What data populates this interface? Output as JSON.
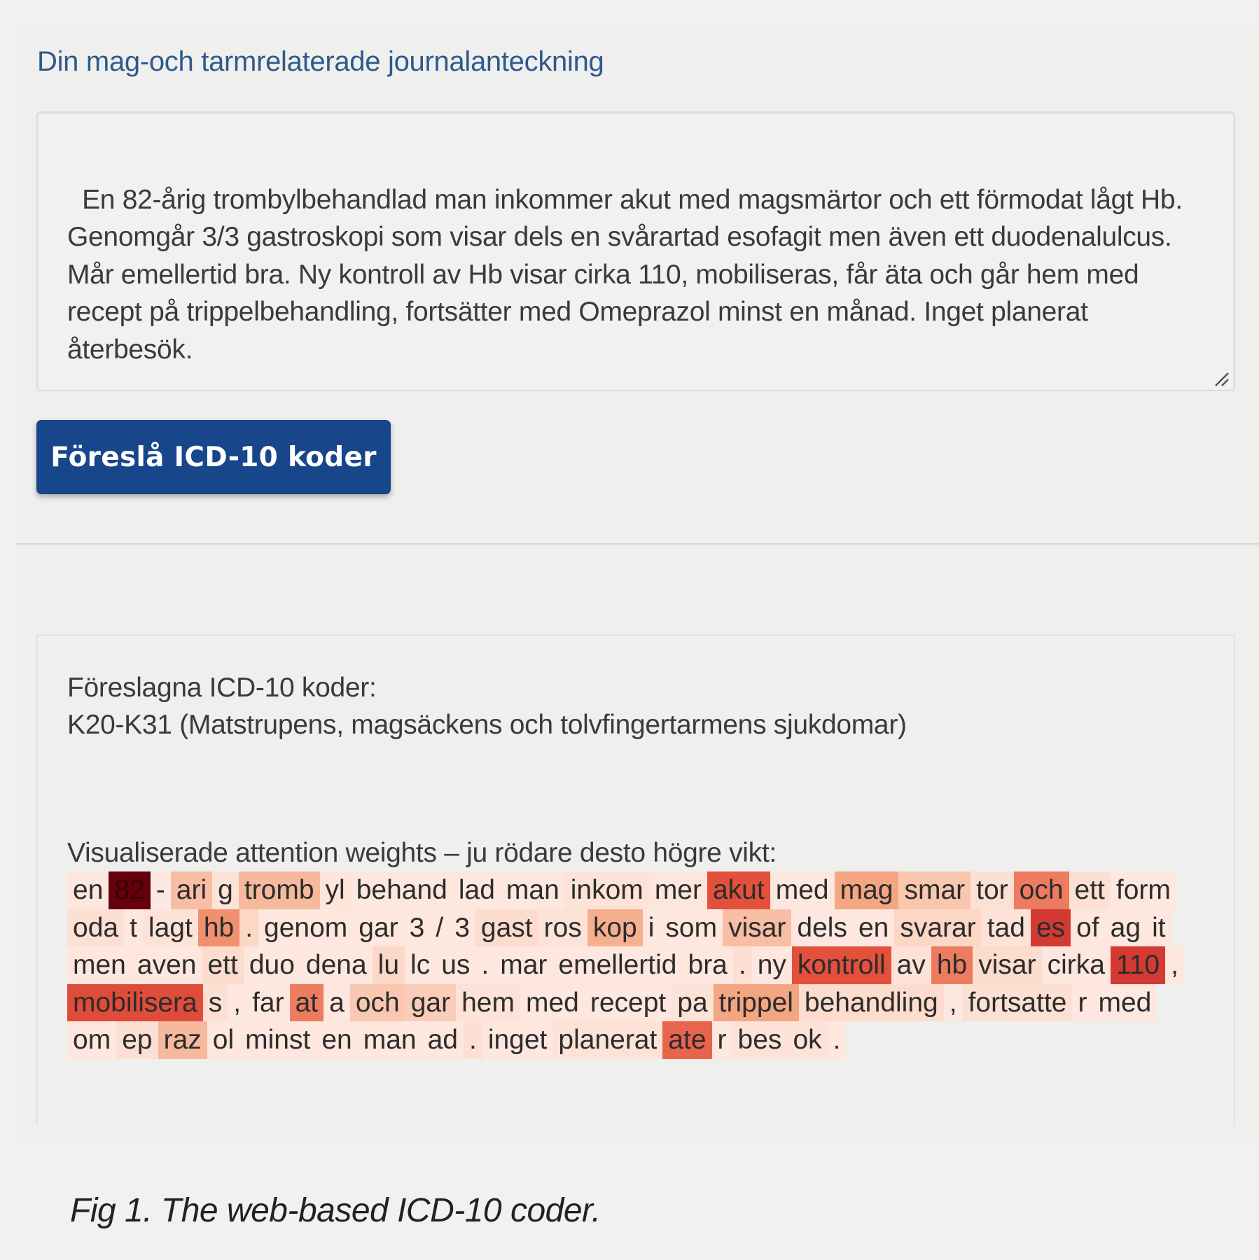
{
  "form": {
    "title": "Din mag-och tarmrelaterade journalanteckning",
    "note_text": "En 82-årig trombylbehandlad man inkommer akut med magsmärtor och ett förmodat lågt Hb. Genomgår 3/3 gastroskopi som visar dels en svårartad esofagit men även ett duodenalulcus. Mår emellertid bra. Ny kontroll av Hb visar cirka 110, mobiliseras, får äta och går hem med recept på trippelbehandling, fortsätter med Omeprazol minst en månad. Inget planerat återbesök.",
    "submit_label": "Föreslå ICD-10 koder"
  },
  "result": {
    "heading": "Föreslagna ICD-10 koder:",
    "code": "K20-K31 (Matstrupens, magsäckens och tolvfingertarmens sjukdomar)",
    "attention_heading": "Visualiserade attention weights – ju rödare desto högre vikt:",
    "tokens": [
      {
        "text": "en",
        "weight": 0.06
      },
      {
        "text": "82",
        "weight": 1.0
      },
      {
        "text": "-",
        "weight": 0.04
      },
      {
        "text": "ari",
        "weight": 0.3
      },
      {
        "text": "g",
        "weight": 0.1
      },
      {
        "text": "tromb",
        "weight": 0.32
      },
      {
        "text": "yl",
        "weight": 0.08
      },
      {
        "text": "behand",
        "weight": 0.06
      },
      {
        "text": "lad",
        "weight": 0.06
      },
      {
        "text": "man",
        "weight": 0.05
      },
      {
        "text": "inkom",
        "weight": 0.1
      },
      {
        "text": "mer",
        "weight": 0.07
      },
      {
        "text": "akut",
        "weight": 0.6
      },
      {
        "text": "med",
        "weight": 0.05
      },
      {
        "text": "mag",
        "weight": 0.4
      },
      {
        "text": "smar",
        "weight": 0.27
      },
      {
        "text": "tor",
        "weight": 0.12
      },
      {
        "text": "och",
        "weight": 0.5
      },
      {
        "text": "ett",
        "weight": 0.12
      },
      {
        "text": "form",
        "weight": 0.06
      },
      {
        "text": "oda",
        "weight": 0.12
      },
      {
        "text": "t",
        "weight": 0.06
      },
      {
        "text": "lagt",
        "weight": 0.1
      },
      {
        "text": "hb",
        "weight": 0.45
      },
      {
        "text": ".",
        "weight": 0.2
      },
      {
        "text": "genom",
        "weight": 0.06
      },
      {
        "text": "gar",
        "weight": 0.06
      },
      {
        "text": "3",
        "weight": 0.06
      },
      {
        "text": "/",
        "weight": 0.05
      },
      {
        "text": "3",
        "weight": 0.06
      },
      {
        "text": "gast",
        "weight": 0.16
      },
      {
        "text": "ros",
        "weight": 0.1
      },
      {
        "text": "kop",
        "weight": 0.36
      },
      {
        "text": "i",
        "weight": 0.06
      },
      {
        "text": "som",
        "weight": 0.06
      },
      {
        "text": "visar",
        "weight": 0.3
      },
      {
        "text": "dels",
        "weight": 0.06
      },
      {
        "text": "en",
        "weight": 0.06
      },
      {
        "text": "svarar",
        "weight": 0.2
      },
      {
        "text": "tad",
        "weight": 0.1
      },
      {
        "text": "es",
        "weight": 0.7
      },
      {
        "text": "of",
        "weight": 0.06
      },
      {
        "text": "ag",
        "weight": 0.06
      },
      {
        "text": "it",
        "weight": 0.06
      },
      {
        "text": "men",
        "weight": 0.06
      },
      {
        "text": "aven",
        "weight": 0.06
      },
      {
        "text": "ett",
        "weight": 0.16
      },
      {
        "text": "duo",
        "weight": 0.06
      },
      {
        "text": "dena",
        "weight": 0.06
      },
      {
        "text": "lu",
        "weight": 0.2
      },
      {
        "text": "lc",
        "weight": 0.06
      },
      {
        "text": "us",
        "weight": 0.06
      },
      {
        "text": ".",
        "weight": 0.06
      },
      {
        "text": "mar",
        "weight": 0.06
      },
      {
        "text": "emellertid",
        "weight": 0.06
      },
      {
        "text": "bra",
        "weight": 0.06
      },
      {
        "text": ".",
        "weight": 0.12
      },
      {
        "text": "ny",
        "weight": 0.06
      },
      {
        "text": "kontroll",
        "weight": 0.6
      },
      {
        "text": "av",
        "weight": 0.1
      },
      {
        "text": "hb",
        "weight": 0.5
      },
      {
        "text": "visar",
        "weight": 0.16
      },
      {
        "text": "cirka",
        "weight": 0.06
      },
      {
        "text": "110",
        "weight": 0.7
      },
      {
        "text": ",",
        "weight": 0.06
      },
      {
        "text": "mobilisera",
        "weight": 0.62
      },
      {
        "text": "s",
        "weight": 0.12
      },
      {
        "text": ",",
        "weight": 0.05
      },
      {
        "text": "far",
        "weight": 0.05
      },
      {
        "text": "at",
        "weight": 0.5
      },
      {
        "text": "a",
        "weight": 0.06
      },
      {
        "text": "och",
        "weight": 0.26
      },
      {
        "text": "gar",
        "weight": 0.24
      },
      {
        "text": "hem",
        "weight": 0.1
      },
      {
        "text": "med",
        "weight": 0.06
      },
      {
        "text": "recept",
        "weight": 0.06
      },
      {
        "text": "pa",
        "weight": 0.1
      },
      {
        "text": "trippel",
        "weight": 0.4
      },
      {
        "text": "behandling",
        "weight": 0.16
      },
      {
        "text": ",",
        "weight": 0.05
      },
      {
        "text": "fortsatte",
        "weight": 0.12
      },
      {
        "text": "r",
        "weight": 0.06
      },
      {
        "text": "med",
        "weight": 0.06
      },
      {
        "text": "om",
        "weight": 0.06
      },
      {
        "text": "ep",
        "weight": 0.12
      },
      {
        "text": "raz",
        "weight": 0.32
      },
      {
        "text": "ol",
        "weight": 0.06
      },
      {
        "text": "minst",
        "weight": 0.06
      },
      {
        "text": "en",
        "weight": 0.06
      },
      {
        "text": "man",
        "weight": 0.06
      },
      {
        "text": "ad",
        "weight": 0.06
      },
      {
        "text": ".",
        "weight": 0.12
      },
      {
        "text": "inget",
        "weight": 0.06
      },
      {
        "text": "planerat",
        "weight": 0.1
      },
      {
        "text": "ate",
        "weight": 0.55
      },
      {
        "text": "r",
        "weight": 0.06
      },
      {
        "text": "bes",
        "weight": 0.1
      },
      {
        "text": "ok",
        "weight": 0.1
      },
      {
        "text": ".",
        "weight": 0.06
      }
    ]
  },
  "caption": "Fig 1. The web-based ICD-10 coder.",
  "colors": {
    "title_blue": "#2e5a8c",
    "button_blue": "#17468a",
    "heat_low": "#fdeee8",
    "heat_high": "#67000d"
  }
}
